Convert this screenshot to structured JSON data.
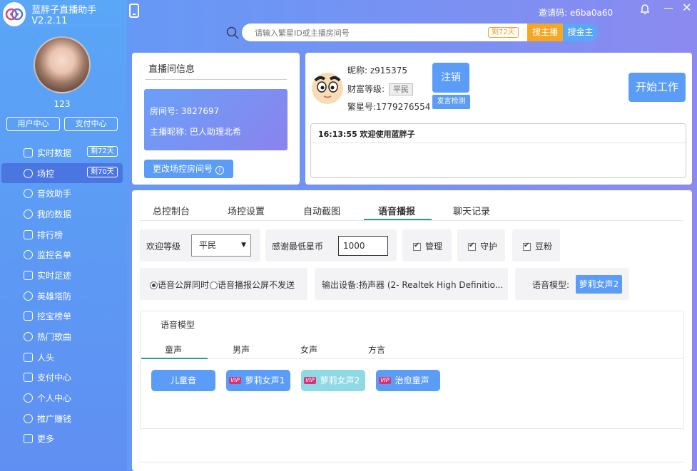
{
  "app": {
    "title": "蓝胖子直播助手V2.2.11"
  },
  "header": {
    "invite_label": "邀请码: e6ba0a60",
    "search_placeholder": "请输入繁星ID或主播房间号",
    "search_badge": "剩72天",
    "search_host_label": "搜主播",
    "search_all_label": "搜金主"
  },
  "user": {
    "name": "123",
    "user_center_label": "用户中心",
    "pay_center_label": "支付中心"
  },
  "sidebar": {
    "items": [
      {
        "label": "实时数据",
        "icon": "monitor-icon",
        "badge": "剩72天"
      },
      {
        "label": "场控",
        "icon": "gamepad-icon",
        "badge": "剩70天",
        "active": true
      },
      {
        "label": "音效助手",
        "icon": "sound-effect-icon"
      },
      {
        "label": "我的数据",
        "icon": "microphone-icon"
      },
      {
        "label": "排行榜",
        "icon": "ranking-icon"
      },
      {
        "label": "监控名单",
        "icon": "watch-icon"
      },
      {
        "label": "实时足迹",
        "icon": "footprint-icon"
      },
      {
        "label": "英雄塔防",
        "icon": "gamepad-icon"
      },
      {
        "label": "挖宝榜单",
        "icon": "gift-icon"
      },
      {
        "label": "热门歌曲",
        "icon": "music-note-icon"
      },
      {
        "label": "人头",
        "icon": "gift-icon"
      },
      {
        "label": "支付中心",
        "icon": "bag-icon"
      },
      {
        "label": "个人中心",
        "icon": "gear-icon"
      },
      {
        "label": "推广赚钱",
        "icon": "share-icon"
      },
      {
        "label": "更多",
        "icon": "grid-icon"
      }
    ]
  },
  "room": {
    "section_title": "直播间信息",
    "room_no": "房间号: 3827697",
    "host_nick": "主播昵称: 巴人助理北希",
    "change_button": "更改场控房间号"
  },
  "account": {
    "nickname": "昵称:  z915375",
    "wealth_label": "财富等级:",
    "wealth_value": "平民",
    "fanxing_no": "繁星号:1779276554",
    "logout_label": "注销",
    "detect_label": "发言检测",
    "start_label": "开始工作"
  },
  "log": {
    "line1": "16:13:55 欢迎使用蓝胖子"
  },
  "tabs": [
    {
      "label": "总控制台"
    },
    {
      "label": "场控设置"
    },
    {
      "label": "自动截图"
    },
    {
      "label": "语音播报",
      "active": true
    },
    {
      "label": "聊天记录"
    }
  ],
  "controls": {
    "welcome_level_label": "欢迎等级",
    "welcome_level_value": "平民",
    "min_coin_label": "感谢最低星币",
    "min_coin_value": "1000",
    "admin_label": "管理",
    "guard_label": "守护",
    "fans_label": "豆粉",
    "radio1_label": "语音公屏同时",
    "radio2_label": "语音播报公屏不发送",
    "output_device": "输出设备:扬声器 (2- Realtek High Definitio...",
    "voice_model_label": "语音模型:",
    "voice_model_value": "萝莉女声2"
  },
  "voice_panel": {
    "title": "语音模型",
    "subtabs": [
      "童声",
      "男声",
      "女声",
      "方言"
    ],
    "buttons": [
      {
        "label": "儿童音",
        "vip": false
      },
      {
        "label": "萝莉女声1",
        "vip": true
      },
      {
        "label": "萝莉女声2",
        "vip": true
      },
      {
        "label": "治愈童声",
        "vip": true
      }
    ],
    "vip_text": "VIP"
  },
  "colors": {
    "accent": "#5b9cf7",
    "active_underline": "#2aa08c",
    "orange": "#f5a623"
  }
}
